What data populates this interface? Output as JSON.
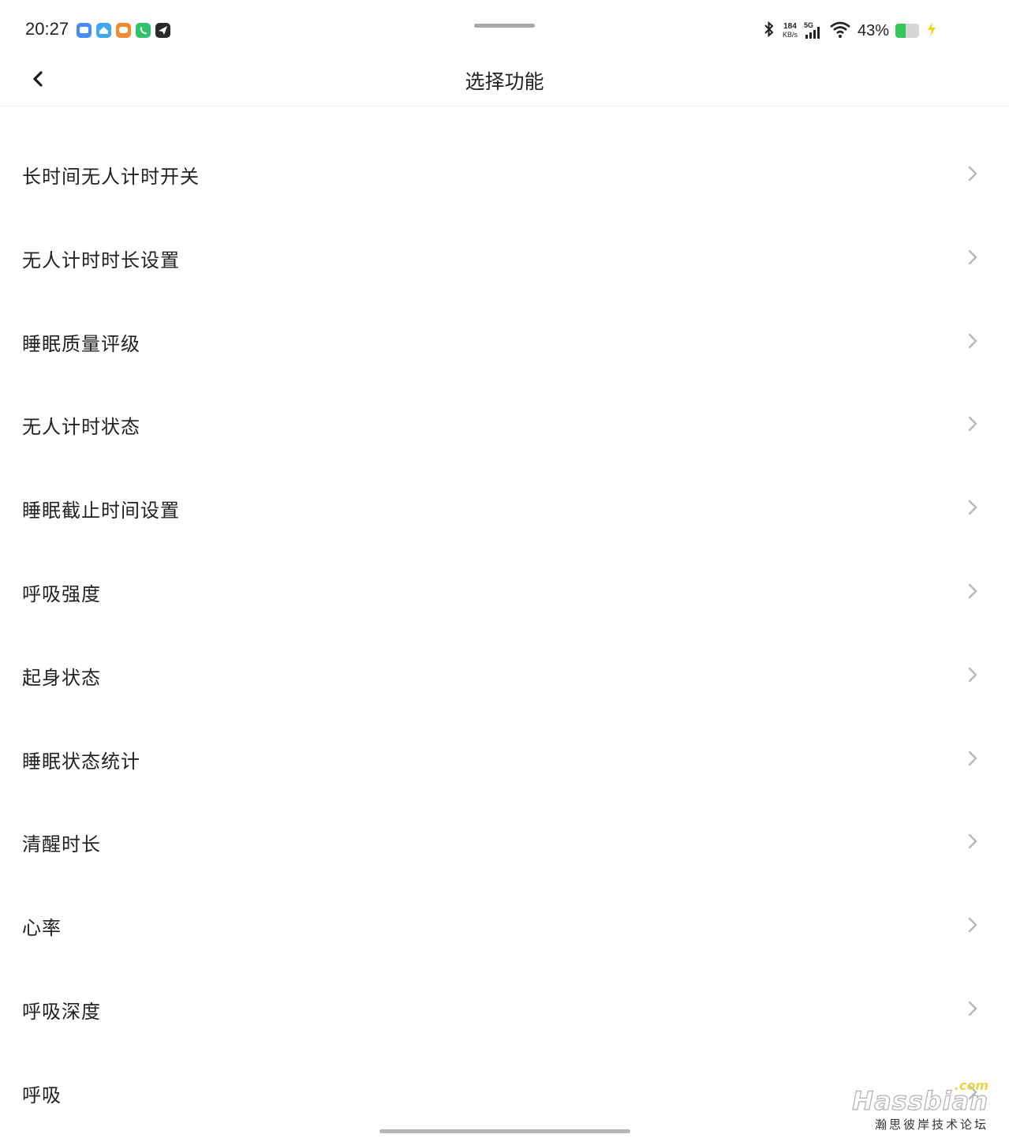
{
  "status_bar": {
    "time": "20:27",
    "notification_icons": [
      {
        "name": "chat-app-icon",
        "color": "#4a8cf7"
      },
      {
        "name": "home-app-icon",
        "color": "#3ea8f0"
      },
      {
        "name": "message-app-icon",
        "color": "#f28a30"
      },
      {
        "name": "phone-app-icon",
        "color": "#2fc46a"
      },
      {
        "name": "send-app-icon",
        "color": "#2a2a2a"
      }
    ],
    "net_speed_value": "184",
    "net_speed_unit": "KB/s",
    "network_type": "5G",
    "battery_percent_text": "43%",
    "battery_level": 0.43,
    "charging": true
  },
  "header": {
    "title": "选择功能"
  },
  "list": {
    "items": [
      {
        "label": "长时间无人计时开关"
      },
      {
        "label": "无人计时时长设置"
      },
      {
        "label": "睡眠质量评级"
      },
      {
        "label": "无人计时状态"
      },
      {
        "label": "睡眠截止时间设置"
      },
      {
        "label": "呼吸强度"
      },
      {
        "label": "起身状态"
      },
      {
        "label": "睡眠状态统计"
      },
      {
        "label": "清醒时长"
      },
      {
        "label": "心率"
      },
      {
        "label": "呼吸深度"
      },
      {
        "label": "呼吸"
      }
    ]
  },
  "watermark": {
    "logo": "Hassbian",
    "suffix": ".com",
    "subtitle": "瀚思彼岸技术论坛"
  },
  "colors": {
    "text": "#222222",
    "chevron": "#b8b8b8",
    "battery_fill": "#34c759",
    "charging_bolt": "#f5d20a"
  }
}
